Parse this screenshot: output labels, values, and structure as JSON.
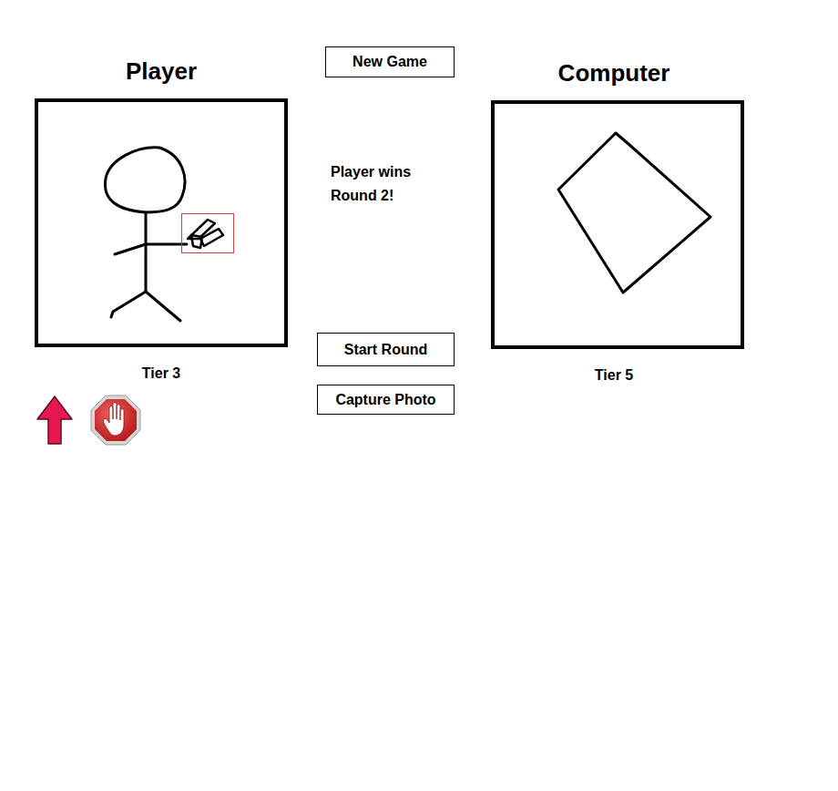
{
  "panels": [
    {
      "name": "Player",
      "tier": "Tier 3",
      "kind": "scissors",
      "highlighted": true,
      "controls": [
        {
          "kind": "arrow"
        },
        {
          "kind": "stop"
        }
      ]
    },
    {
      "name": "Computer",
      "tier": "Tier 5",
      "kind": "paper",
      "highlighted": false,
      "controls": []
    }
  ],
  "status": "Player wins Round 2!",
  "buttons": [
    {
      "label": "New Game",
      "kind": "new"
    },
    {
      "label": "Start Round",
      "kind": "start"
    },
    {
      "label": "Capture Photo",
      "kind": "capture"
    }
  ]
}
